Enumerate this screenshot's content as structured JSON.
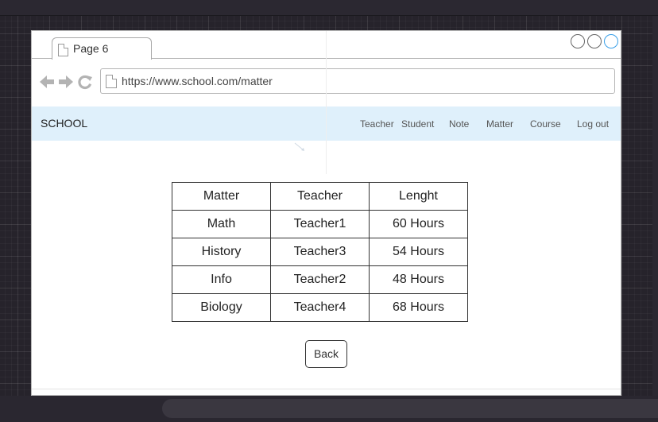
{
  "browser": {
    "tab": {
      "label": "Page 6"
    },
    "address": {
      "url": "https://www.school.com/matter"
    },
    "window_controls": [
      "minimize",
      "maximize",
      "close"
    ]
  },
  "navbar": {
    "brand": "SCHOOL",
    "items": [
      {
        "label": "Teacher"
      },
      {
        "label": "Student"
      },
      {
        "label": "Note"
      },
      {
        "label": "Matter"
      },
      {
        "label": "Course"
      },
      {
        "label": "Log out"
      }
    ]
  },
  "table": {
    "headers": [
      "Matter",
      "Teacher",
      "Lenght"
    ],
    "rows": [
      [
        "Math",
        "Teacher1",
        "60 Hours"
      ],
      [
        "History",
        "Teacher3",
        "54 Hours"
      ],
      [
        "Info",
        "Teacher2",
        "48 Hours"
      ],
      [
        "Biology",
        "Teacher4",
        "68 Hours"
      ]
    ]
  },
  "actions": {
    "back_label": "Back"
  },
  "colors": {
    "navbar_bg": "#dff0fb",
    "canvas_bg": "#26232b",
    "accent_control": "#3aa0e8"
  }
}
